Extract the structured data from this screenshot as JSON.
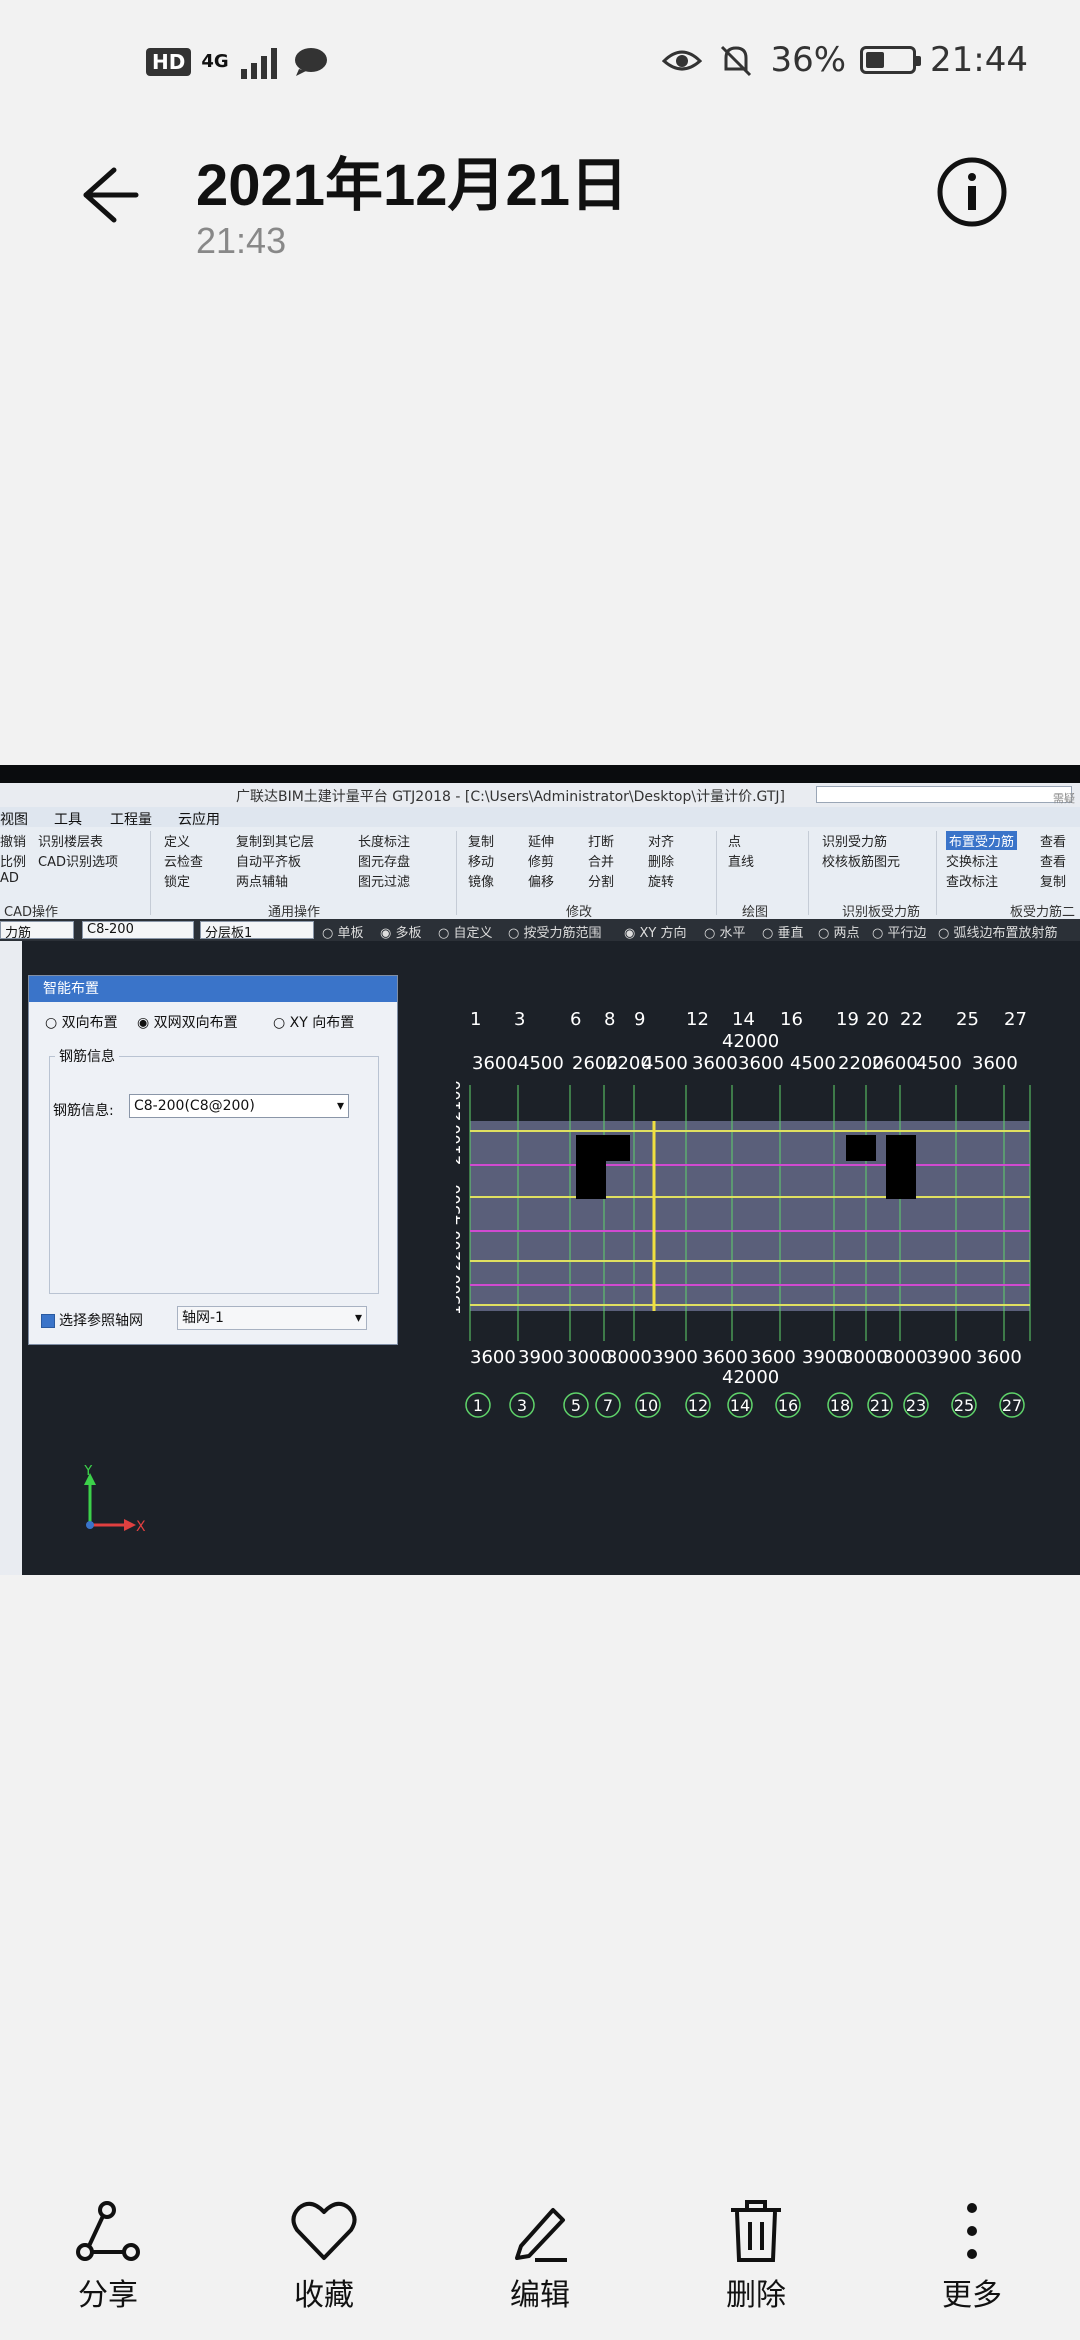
{
  "statusbar": {
    "hd": "HD",
    "network": "4G",
    "battery_pct": "36%",
    "battery_level": 0.36,
    "time": "21:44"
  },
  "header": {
    "title": "2021年12月21日",
    "subtitle": "21:43"
  },
  "photo": {
    "app_title": "广联达BIM土建计量平台 GTJ2018 - [C:\\Users\\Administrator\\Desktop\\计量计价.GTJ]",
    "menu": [
      "视图",
      "工具",
      "工程量",
      "云应用"
    ],
    "search_placeholder": "需疑解惑，搜这里",
    "ribbon": {
      "col1": [
        "撤销",
        "比例",
        "AD"
      ],
      "col2": [
        "识别楼层表",
        "CAD识别选项"
      ],
      "col3": [
        "定义",
        "云检查",
        "锁定"
      ],
      "col4": [
        "复制到其它层",
        "自动平齐板",
        "两点辅轴"
      ],
      "col5": [
        "长度标注",
        "图元存盘",
        "图元过滤"
      ],
      "col6": [
        "复制",
        "移动",
        "镜像"
      ],
      "col7": [
        "延伸",
        "修剪",
        "偏移"
      ],
      "col8": [
        "打断",
        "合并",
        "分割"
      ],
      "col9": [
        "对齐",
        "删除",
        "旋转"
      ],
      "col10": [
        "点",
        "直线"
      ],
      "col11": [
        "识别受力筋",
        "校核板筋图元"
      ],
      "col12": [
        "布置受力筋",
        "交换标注",
        "查改标注"
      ],
      "col13": [
        "查看",
        "查看",
        "复制"
      ],
      "groups": [
        "CAD操作",
        "通用操作",
        "修改",
        "绘图",
        "识别板受力筋",
        "板受力筋二次"
      ]
    },
    "optbar": {
      "combo1": "力筋",
      "combo2": "C8-200",
      "combo3": "分层板1",
      "radios": [
        "单板",
        "多板",
        "自定义",
        "按受力筋范围",
        "XY 方向",
        "水平",
        "垂直",
        "两点",
        "平行边",
        "弧线边布置放射筋"
      ],
      "selected": [
        "多板",
        "XY 方向"
      ]
    },
    "dialog": {
      "title": "智能布置",
      "options": [
        "双向布置",
        "双网双向布置",
        "XY 向布置"
      ],
      "selected_option": "双网双向布置",
      "group_label": "钢筋信息",
      "rebar_label": "钢筋信息:",
      "rebar_value": "C8-200(C8@200)",
      "ref_axis_label": "选择参照轴网",
      "ref_axis_value": "轴网-1"
    },
    "plan": {
      "top_axis_labels": [
        "1",
        "3",
        "6",
        "8",
        "9",
        "12",
        "14",
        "16",
        "19",
        "20",
        "22",
        "25",
        "27"
      ],
      "top_total": "42000",
      "top_dims": [
        "3600",
        "4500",
        "2600",
        "2200",
        "4500",
        "3600",
        "3600",
        "4500",
        "2200",
        "2600",
        "4500",
        "3600"
      ],
      "bottom_dims": [
        "3600",
        "3900",
        "3000",
        "3000",
        "3900",
        "3600",
        "3600",
        "3900",
        "3000",
        "3000",
        "3900",
        "3600"
      ],
      "bottom_total": "42000",
      "bottom_axis_labels": [
        "1",
        "3",
        "5",
        "7",
        "10",
        "12",
        "14",
        "16",
        "18",
        "21",
        "23",
        "25",
        "27"
      ],
      "left_dims": [
        "12000",
        "2100",
        "4500",
        "2200",
        "1200",
        "1500",
        "2100"
      ]
    },
    "axis_icon": {
      "x": "X",
      "y": "Y"
    }
  },
  "bottom_actions": [
    {
      "label": "分享",
      "icon": "share-icon"
    },
    {
      "label": "收藏",
      "icon": "heart-icon"
    },
    {
      "label": "编辑",
      "icon": "edit-icon"
    },
    {
      "label": "删除",
      "icon": "trash-icon"
    },
    {
      "label": "更多",
      "icon": "more-icon"
    }
  ]
}
